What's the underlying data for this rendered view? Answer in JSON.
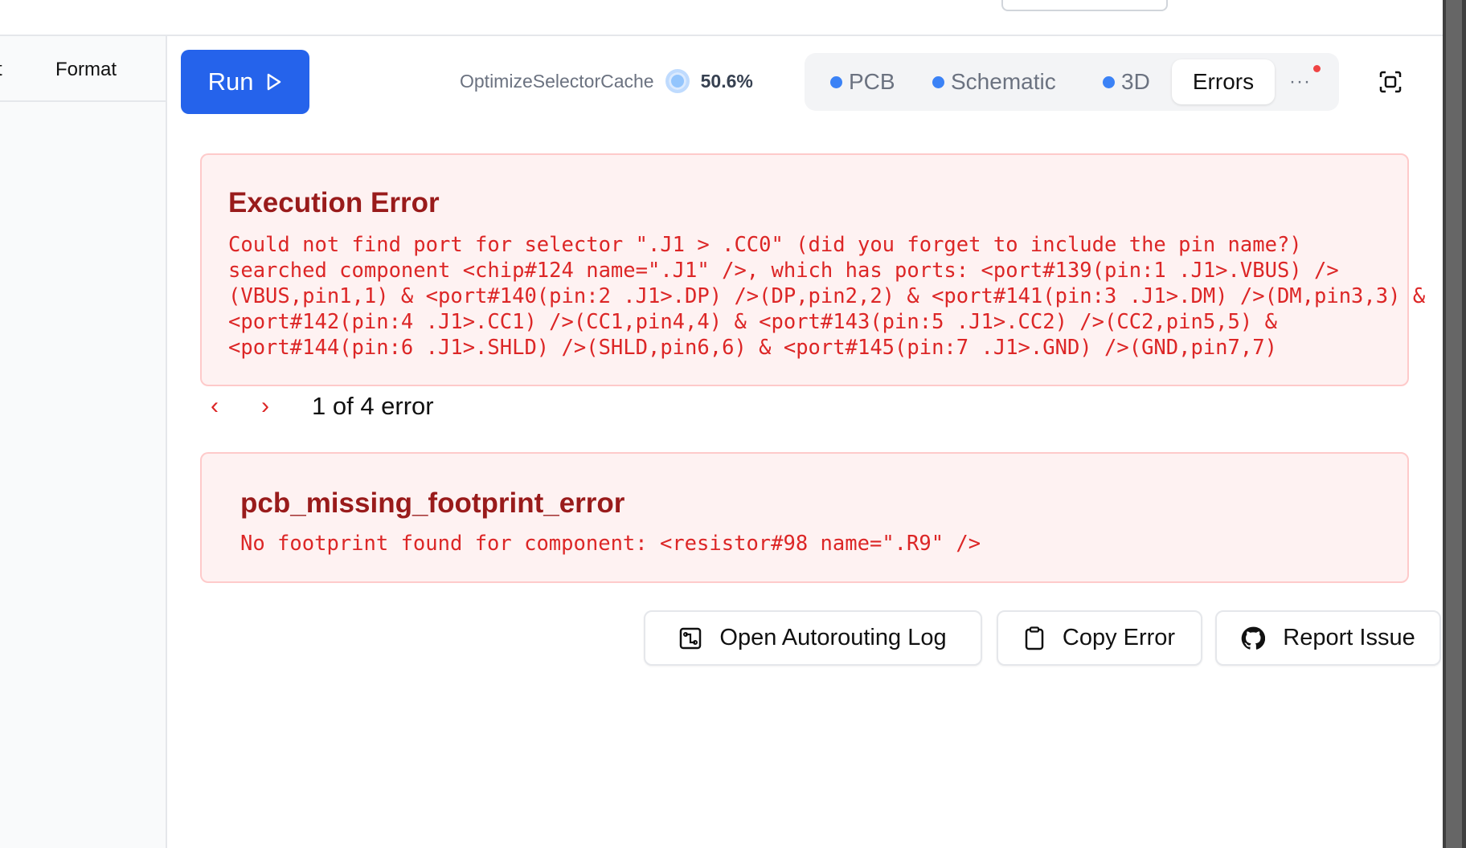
{
  "sidebar": {
    "tabs": [
      "t",
      "Format"
    ]
  },
  "toolbar": {
    "run_label": "Run",
    "status_task": "OptimizeSelectorCache",
    "status_progress": "50.6%",
    "tabs": [
      {
        "label": "PCB"
      },
      {
        "label": "Schematic"
      },
      {
        "label": "3D"
      },
      {
        "label": "Errors",
        "active": true
      }
    ],
    "more_label": "···"
  },
  "errors": [
    {
      "title": "Execution Error",
      "message": "Could not find port for selector \".J1 > .CC0\" (did you forget to include the pin name?)\nsearched component <chip#124 name=\".J1\" />, which has ports: <port#139(pin:1 .J1>.VBUS) />\n(VBUS,pin1,1) & <port#140(pin:2 .J1>.DP) />(DP,pin2,2) & <port#141(pin:3 .J1>.DM) />(DM,pin3,3) &\n<port#142(pin:4 .J1>.CC1) />(CC1,pin4,4) & <port#143(pin:5 .J1>.CC2) />(CC2,pin5,5) &\n<port#144(pin:6 .J1>.SHLD) />(SHLD,pin6,6) & <port#145(pin:7 .J1>.GND) />(GND,pin7,7)"
    },
    {
      "title": "pcb_missing_footprint_error",
      "message": "No footprint found for component: <resistor#98 name=\".R9\" />"
    }
  ],
  "pager": {
    "prev": "‹",
    "next": "›",
    "text": "1 of 4 error"
  },
  "actions": {
    "autorouting_log": "Open Autorouting Log",
    "copy_error": "Copy Error",
    "report_issue": "Report Issue"
  }
}
